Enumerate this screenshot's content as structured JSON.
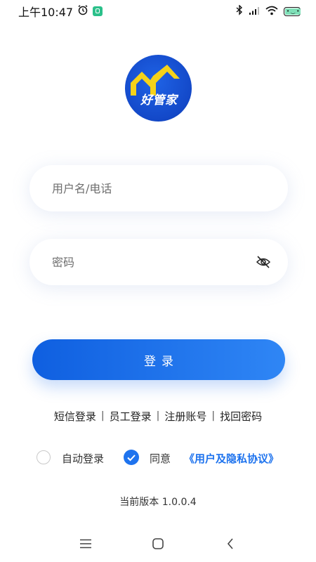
{
  "status_bar": {
    "time": "上午10:47",
    "icons": [
      "alarm-icon",
      "app-notification-icon",
      "bluetooth-icon",
      "signal-icon",
      "wifi-icon",
      "battery-icon"
    ]
  },
  "logo": {
    "text": "好管家",
    "colors": {
      "background": "#1348c8",
      "house": "#f5d21a",
      "text": "#ffffff"
    }
  },
  "form": {
    "username_placeholder": "用户名/电话",
    "password_placeholder": "密码",
    "password_toggle_icon": "eye-slash-icon",
    "login_label": "登录"
  },
  "links": [
    "短信登录",
    "员工登录",
    "注册账号",
    "找回密码"
  ],
  "link_separator": "|",
  "options": {
    "auto_login_label": "自动登录",
    "auto_login_checked": false,
    "agree_label": "同意",
    "agree_checked": true,
    "agreement_link": "《用户及隐私协议》"
  },
  "version_text": "当前版本 1.0.0.4",
  "nav": [
    "menu-icon",
    "home-icon",
    "back-icon"
  ],
  "colors": {
    "accent": "#1e73ee",
    "button_start": "#0f5fe0",
    "button_end": "#2f86f5"
  }
}
